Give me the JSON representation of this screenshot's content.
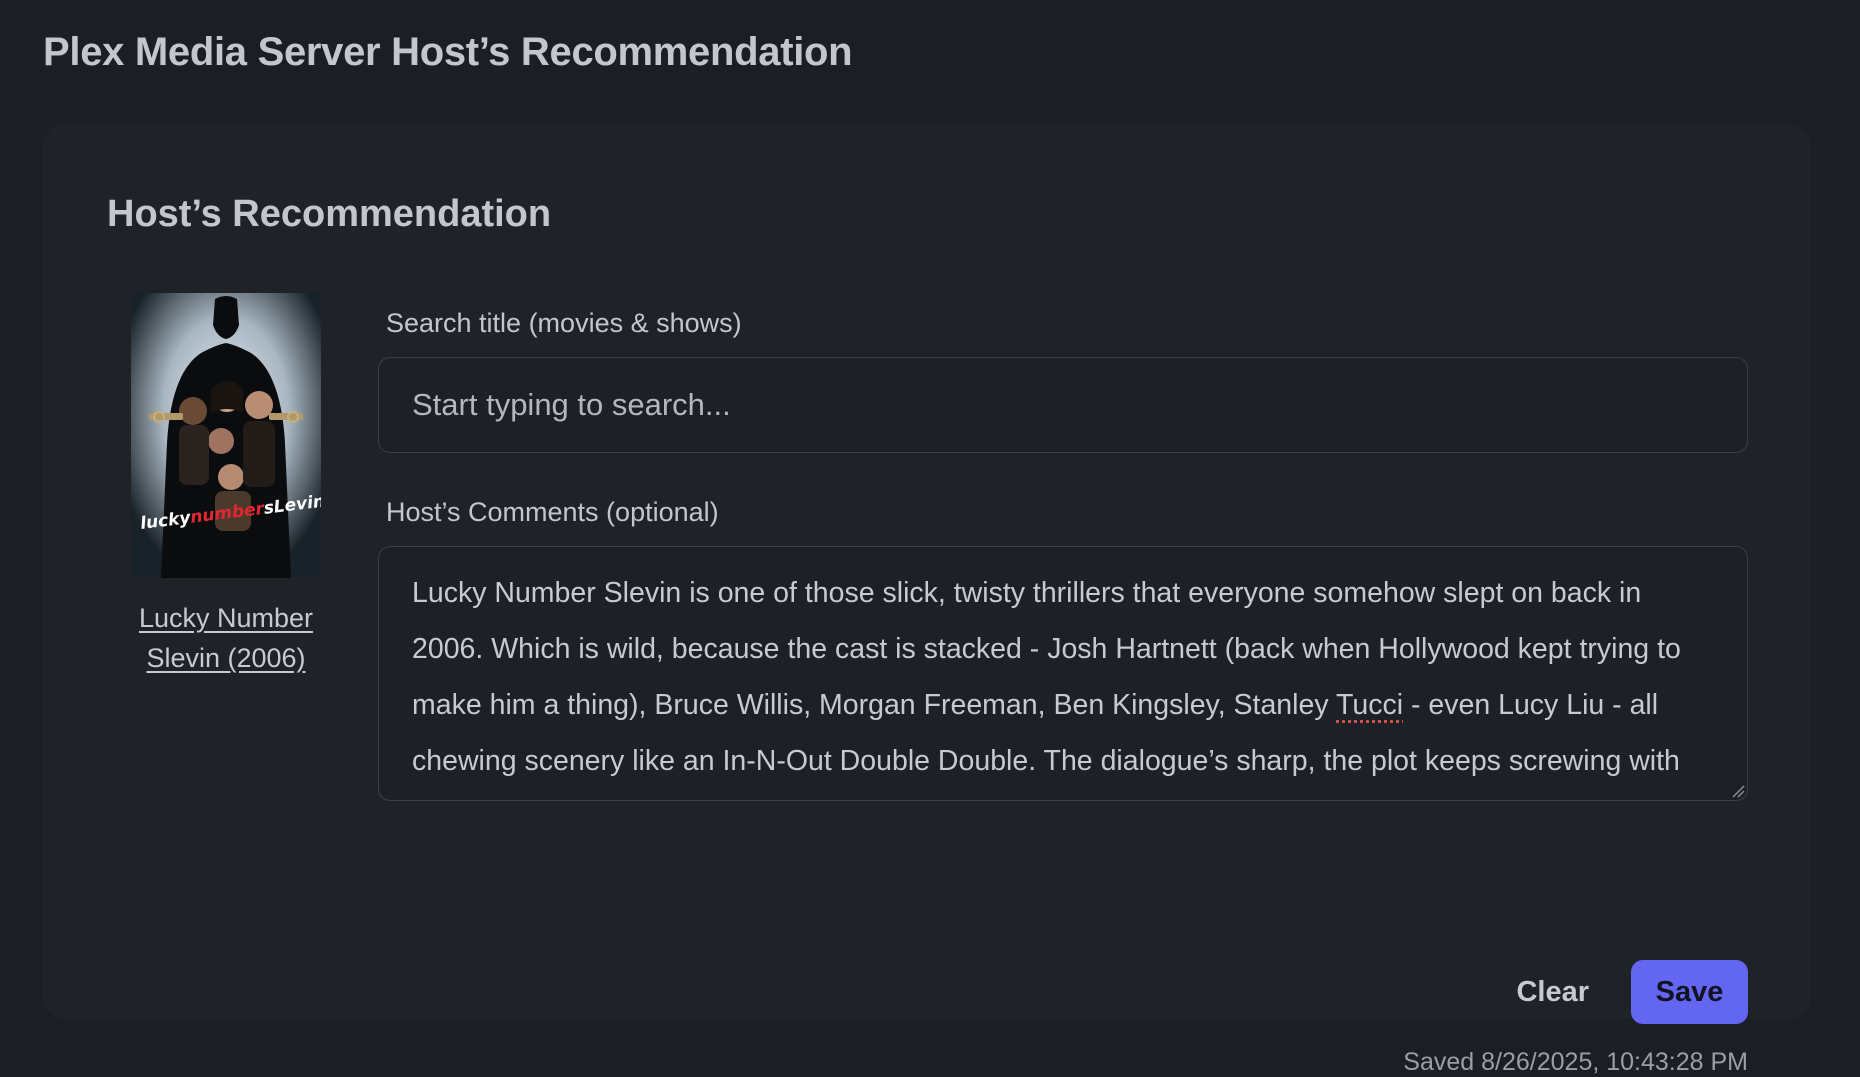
{
  "page": {
    "title": "Plex Media Server Host’s Recommendation"
  },
  "card": {
    "title": "Host’s Recommendation"
  },
  "poster": {
    "logo_text": "luckynumberslevin",
    "link_text": "Lucky Number Slevin (2006)"
  },
  "search": {
    "label": "Search title (movies & shows)",
    "placeholder": "Start typing to search...",
    "value": ""
  },
  "comments": {
    "label": "Host’s Comments (optional)",
    "text_before": "Lucky Number Slevin is one of those slick, twisty thrillers that everyone somehow slept on back in 2006. Which is wild, because the cast is stacked - Josh Hartnett (back when Hollywood kept trying to make him a thing), Bruce Willis, Morgan Freeman, Ben Kingsley, Stanley ",
    "misspelled_word": "Tucci",
    "text_after": " - even Lucy Liu - all chewing scenery like an In-N-Out Double Double. The dialogue’s sharp, the plot keeps screwing with"
  },
  "actions": {
    "clear_label": "Clear",
    "save_label": "Save"
  },
  "status": {
    "saved_text": "Saved 8/26/2025, 10:43:28 PM"
  },
  "colors": {
    "background": "#1b1e23",
    "card": "#1f2328",
    "accent": "#6366f1",
    "spellcheck": "#d9534f"
  }
}
